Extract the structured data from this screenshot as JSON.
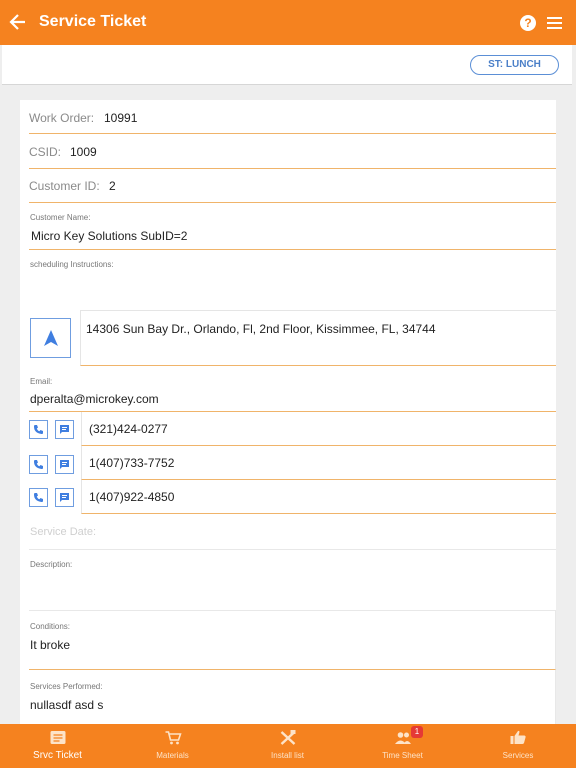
{
  "header": {
    "title": "Service Ticket",
    "help_glyph": "?"
  },
  "status": {
    "label": "ST: LUNCH"
  },
  "fields": {
    "work_order": {
      "label": "Work Order:",
      "value": "10991"
    },
    "csid": {
      "label": "CSID:",
      "value": "1009"
    },
    "customer_id": {
      "label": "Customer ID:",
      "value": "2"
    },
    "customer_name": {
      "label": "Customer Name:",
      "value": "Micro Key Solutions SubID=2"
    },
    "scheduling": {
      "label": "scheduling Instructions:",
      "value": ""
    },
    "address": "14306 Sun Bay Dr., Orlando, Fl, 2nd Floor, Kissimmee, FL,  34744",
    "email": {
      "label": "Email:",
      "value": "dperalta@microkey.com"
    },
    "phones": [
      "(321)424-0277",
      "1(407)733-7752",
      "1(407)922-4850"
    ],
    "service_date": {
      "placeholder": "Service Date:"
    },
    "description": {
      "label": "Description:",
      "value": ""
    },
    "conditions": {
      "label": "Conditions:",
      "value": "It broke"
    },
    "services_performed": {
      "label": "Services Performed:",
      "value": "nullasdf asd s"
    }
  },
  "tabs": [
    {
      "label": "Srvc Ticket",
      "icon": "ticket-icon"
    },
    {
      "label": "Materials",
      "icon": "cart-icon"
    },
    {
      "label": "Install list",
      "icon": "tools-icon"
    },
    {
      "label": "Time Sheet",
      "icon": "people-icon",
      "badge": "1"
    },
    {
      "label": "Services",
      "icon": "thumbs-up-icon"
    }
  ],
  "colors": {
    "accent": "#f5821f",
    "link": "#5b8fd6",
    "underline": "#f0b46a"
  }
}
